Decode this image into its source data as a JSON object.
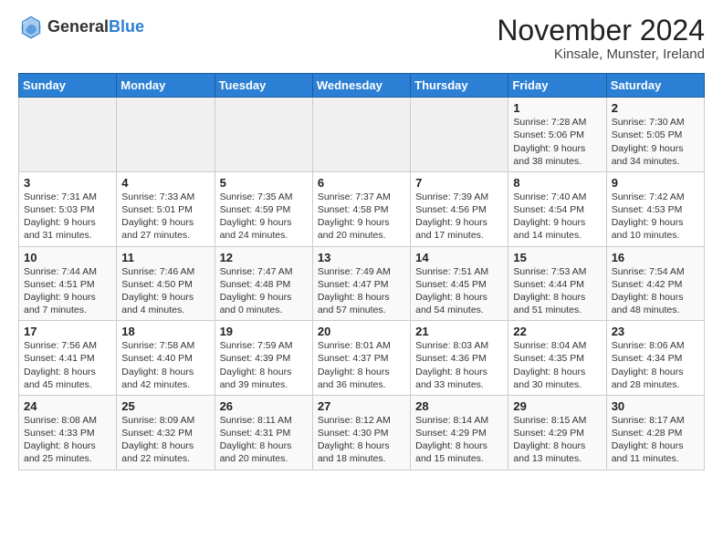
{
  "logo": {
    "general": "General",
    "blue": "Blue"
  },
  "header": {
    "month": "November 2024",
    "location": "Kinsale, Munster, Ireland"
  },
  "weekdays": [
    "Sunday",
    "Monday",
    "Tuesday",
    "Wednesday",
    "Thursday",
    "Friday",
    "Saturday"
  ],
  "weeks": [
    [
      {
        "day": "",
        "info": ""
      },
      {
        "day": "",
        "info": ""
      },
      {
        "day": "",
        "info": ""
      },
      {
        "day": "",
        "info": ""
      },
      {
        "day": "",
        "info": ""
      },
      {
        "day": "1",
        "info": "Sunrise: 7:28 AM\nSunset: 5:06 PM\nDaylight: 9 hours\nand 38 minutes."
      },
      {
        "day": "2",
        "info": "Sunrise: 7:30 AM\nSunset: 5:05 PM\nDaylight: 9 hours\nand 34 minutes."
      }
    ],
    [
      {
        "day": "3",
        "info": "Sunrise: 7:31 AM\nSunset: 5:03 PM\nDaylight: 9 hours\nand 31 minutes."
      },
      {
        "day": "4",
        "info": "Sunrise: 7:33 AM\nSunset: 5:01 PM\nDaylight: 9 hours\nand 27 minutes."
      },
      {
        "day": "5",
        "info": "Sunrise: 7:35 AM\nSunset: 4:59 PM\nDaylight: 9 hours\nand 24 minutes."
      },
      {
        "day": "6",
        "info": "Sunrise: 7:37 AM\nSunset: 4:58 PM\nDaylight: 9 hours\nand 20 minutes."
      },
      {
        "day": "7",
        "info": "Sunrise: 7:39 AM\nSunset: 4:56 PM\nDaylight: 9 hours\nand 17 minutes."
      },
      {
        "day": "8",
        "info": "Sunrise: 7:40 AM\nSunset: 4:54 PM\nDaylight: 9 hours\nand 14 minutes."
      },
      {
        "day": "9",
        "info": "Sunrise: 7:42 AM\nSunset: 4:53 PM\nDaylight: 9 hours\nand 10 minutes."
      }
    ],
    [
      {
        "day": "10",
        "info": "Sunrise: 7:44 AM\nSunset: 4:51 PM\nDaylight: 9 hours\nand 7 minutes."
      },
      {
        "day": "11",
        "info": "Sunrise: 7:46 AM\nSunset: 4:50 PM\nDaylight: 9 hours\nand 4 minutes."
      },
      {
        "day": "12",
        "info": "Sunrise: 7:47 AM\nSunset: 4:48 PM\nDaylight: 9 hours\nand 0 minutes."
      },
      {
        "day": "13",
        "info": "Sunrise: 7:49 AM\nSunset: 4:47 PM\nDaylight: 8 hours\nand 57 minutes."
      },
      {
        "day": "14",
        "info": "Sunrise: 7:51 AM\nSunset: 4:45 PM\nDaylight: 8 hours\nand 54 minutes."
      },
      {
        "day": "15",
        "info": "Sunrise: 7:53 AM\nSunset: 4:44 PM\nDaylight: 8 hours\nand 51 minutes."
      },
      {
        "day": "16",
        "info": "Sunrise: 7:54 AM\nSunset: 4:42 PM\nDaylight: 8 hours\nand 48 minutes."
      }
    ],
    [
      {
        "day": "17",
        "info": "Sunrise: 7:56 AM\nSunset: 4:41 PM\nDaylight: 8 hours\nand 45 minutes."
      },
      {
        "day": "18",
        "info": "Sunrise: 7:58 AM\nSunset: 4:40 PM\nDaylight: 8 hours\nand 42 minutes."
      },
      {
        "day": "19",
        "info": "Sunrise: 7:59 AM\nSunset: 4:39 PM\nDaylight: 8 hours\nand 39 minutes."
      },
      {
        "day": "20",
        "info": "Sunrise: 8:01 AM\nSunset: 4:37 PM\nDaylight: 8 hours\nand 36 minutes."
      },
      {
        "day": "21",
        "info": "Sunrise: 8:03 AM\nSunset: 4:36 PM\nDaylight: 8 hours\nand 33 minutes."
      },
      {
        "day": "22",
        "info": "Sunrise: 8:04 AM\nSunset: 4:35 PM\nDaylight: 8 hours\nand 30 minutes."
      },
      {
        "day": "23",
        "info": "Sunrise: 8:06 AM\nSunset: 4:34 PM\nDaylight: 8 hours\nand 28 minutes."
      }
    ],
    [
      {
        "day": "24",
        "info": "Sunrise: 8:08 AM\nSunset: 4:33 PM\nDaylight: 8 hours\nand 25 minutes."
      },
      {
        "day": "25",
        "info": "Sunrise: 8:09 AM\nSunset: 4:32 PM\nDaylight: 8 hours\nand 22 minutes."
      },
      {
        "day": "26",
        "info": "Sunrise: 8:11 AM\nSunset: 4:31 PM\nDaylight: 8 hours\nand 20 minutes."
      },
      {
        "day": "27",
        "info": "Sunrise: 8:12 AM\nSunset: 4:30 PM\nDaylight: 8 hours\nand 18 minutes."
      },
      {
        "day": "28",
        "info": "Sunrise: 8:14 AM\nSunset: 4:29 PM\nDaylight: 8 hours\nand 15 minutes."
      },
      {
        "day": "29",
        "info": "Sunrise: 8:15 AM\nSunset: 4:29 PM\nDaylight: 8 hours\nand 13 minutes."
      },
      {
        "day": "30",
        "info": "Sunrise: 8:17 AM\nSunset: 4:28 PM\nDaylight: 8 hours\nand 11 minutes."
      }
    ]
  ]
}
